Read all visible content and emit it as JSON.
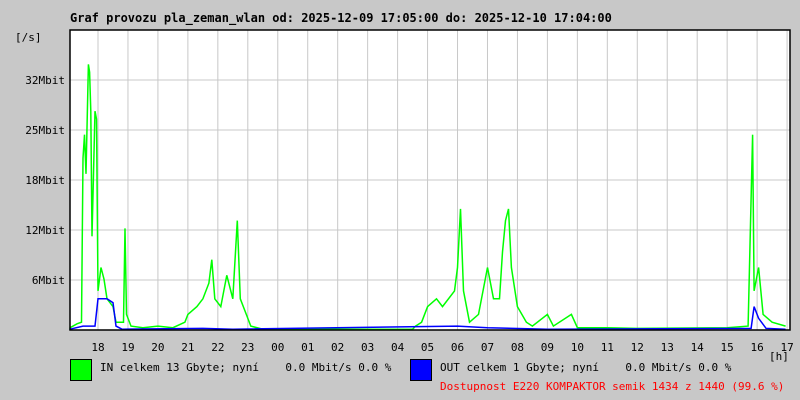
{
  "chart_data": {
    "type": "area",
    "title": "Graf provozu pla_zeman_wlan od: 2025-12-09 17:05:00 do: 2025-12-10 17:04:00",
    "ylabel": "[/s]",
    "xlabel": "[h]",
    "ylim": [
      0,
      38.4
    ],
    "yticks": [
      {
        "v": 6.4,
        "label": "6Mbit"
      },
      {
        "v": 12.8,
        "label": "12Mbit"
      },
      {
        "v": 19.2,
        "label": "18Mbit"
      },
      {
        "v": 25.6,
        "label": "25Mbit"
      },
      {
        "v": 32,
        "label": "32Mbit"
      }
    ],
    "xticks": [
      "18",
      "19",
      "20",
      "21",
      "22",
      "23",
      "00",
      "01",
      "02",
      "03",
      "04",
      "05",
      "06",
      "07",
      "08",
      "09",
      "10",
      "11",
      "12",
      "13",
      "14",
      "15",
      "16",
      "17"
    ],
    "grid": true,
    "series": [
      {
        "name": "IN",
        "color": "#00ff00",
        "points": [
          [
            0.07,
            0.3
          ],
          [
            0.3,
            0.8
          ],
          [
            0.45,
            1
          ],
          [
            0.5,
            22
          ],
          [
            0.55,
            25
          ],
          [
            0.6,
            20
          ],
          [
            0.68,
            34
          ],
          [
            0.72,
            33
          ],
          [
            0.76,
            28
          ],
          [
            0.8,
            12
          ],
          [
            0.85,
            20
          ],
          [
            0.9,
            28
          ],
          [
            0.95,
            27
          ],
          [
            1.0,
            5
          ],
          [
            1.1,
            8
          ],
          [
            1.2,
            6.5
          ],
          [
            1.3,
            4
          ],
          [
            1.5,
            3
          ],
          [
            1.6,
            1
          ],
          [
            1.85,
            1
          ],
          [
            1.9,
            13
          ],
          [
            1.95,
            2
          ],
          [
            2.1,
            0.5
          ],
          [
            2.5,
            0.3
          ],
          [
            3.0,
            0.5
          ],
          [
            3.5,
            0.3
          ],
          [
            3.9,
            1
          ],
          [
            4.0,
            2
          ],
          [
            4.3,
            3
          ],
          [
            4.5,
            4
          ],
          [
            4.7,
            6
          ],
          [
            4.8,
            9
          ],
          [
            4.9,
            4
          ],
          [
            5.1,
            3
          ],
          [
            5.2,
            5
          ],
          [
            5.3,
            7
          ],
          [
            5.5,
            4
          ],
          [
            5.65,
            14
          ],
          [
            5.75,
            4
          ],
          [
            5.95,
            2
          ],
          [
            6.1,
            0.5
          ],
          [
            6.5,
            0.1
          ],
          [
            11.5,
            0.1
          ],
          [
            11.6,
            0.5
          ],
          [
            11.8,
            1
          ],
          [
            12.0,
            3
          ],
          [
            12.3,
            4
          ],
          [
            12.5,
            3
          ],
          [
            12.9,
            5
          ],
          [
            13.0,
            8
          ],
          [
            13.1,
            15.5
          ],
          [
            13.2,
            5
          ],
          [
            13.4,
            1
          ],
          [
            13.7,
            2
          ],
          [
            13.9,
            6
          ],
          [
            14.0,
            8
          ],
          [
            14.2,
            4
          ],
          [
            14.4,
            4
          ],
          [
            14.5,
            10
          ],
          [
            14.6,
            14
          ],
          [
            14.7,
            15.5
          ],
          [
            14.8,
            8
          ],
          [
            15.0,
            3
          ],
          [
            15.3,
            1
          ],
          [
            15.5,
            0.5
          ],
          [
            16.0,
            2
          ],
          [
            16.2,
            0.5
          ],
          [
            16.8,
            2
          ],
          [
            17.0,
            0.3
          ],
          [
            18.0,
            0.3
          ],
          [
            19.0,
            0.2
          ],
          [
            22.0,
            0.3
          ],
          [
            22.7,
            0.5
          ],
          [
            22.85,
            25
          ],
          [
            22.9,
            5
          ],
          [
            23.05,
            8
          ],
          [
            23.2,
            2
          ],
          [
            23.5,
            1
          ],
          [
            23.95,
            0.5
          ]
        ]
      },
      {
        "name": "OUT",
        "color": "#0000ff",
        "points": [
          [
            0.07,
            0.1
          ],
          [
            0.5,
            0.5
          ],
          [
            0.9,
            0.5
          ],
          [
            1.0,
            4
          ],
          [
            1.3,
            4
          ],
          [
            1.5,
            3.5
          ],
          [
            1.6,
            0.5
          ],
          [
            1.8,
            0.1
          ],
          [
            4.5,
            0.2
          ],
          [
            5.5,
            0.1
          ],
          [
            13.0,
            0.5
          ],
          [
            14.0,
            0.3
          ],
          [
            16.0,
            0.1
          ],
          [
            22.8,
            0.2
          ],
          [
            22.9,
            3
          ],
          [
            23.05,
            1.5
          ],
          [
            23.3,
            0.2
          ],
          [
            23.95,
            0.1
          ]
        ]
      }
    ]
  },
  "legend": {
    "in_text": "IN celkem 13 Gbyte; nyní    0.0 Mbit/s 0.0 %",
    "out_text": "OUT celkem 1 Gbyte; nyní    0.0 Mbit/s 0.0 %",
    "availability": "Dostupnost E220 KOMPAKTOR semik 1434 z 1440 (99.6 %)",
    "availability_color": "#ff0000"
  }
}
